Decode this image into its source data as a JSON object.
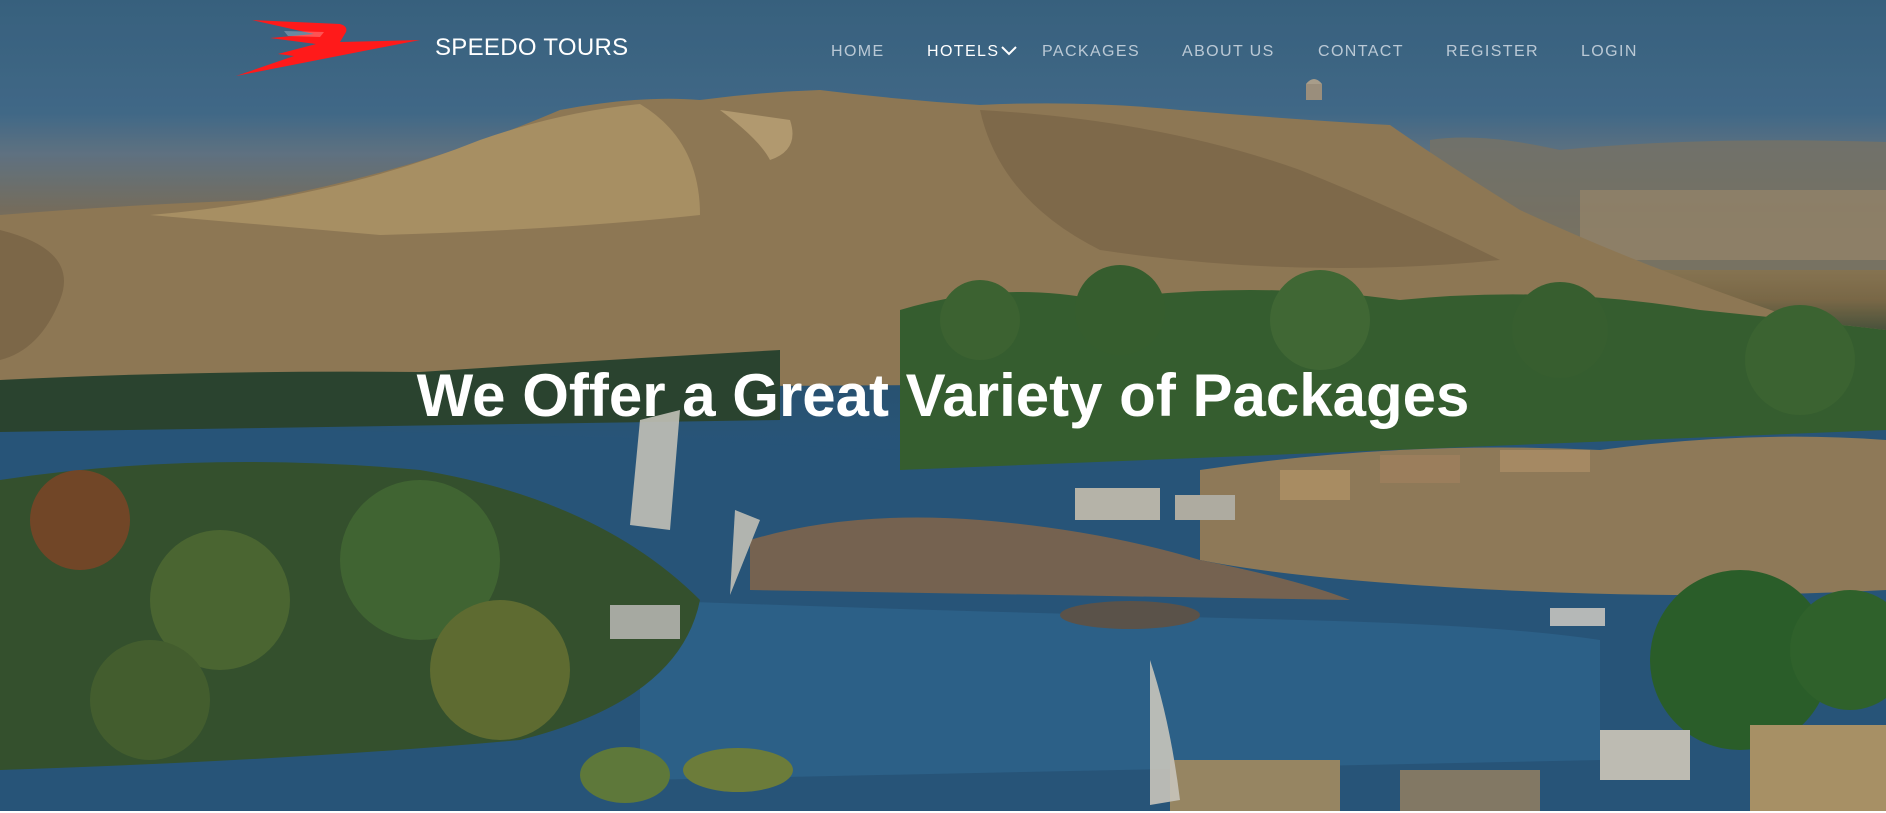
{
  "brand": {
    "name": "SPEEDO TOURS",
    "logo_icon": "speedo-wing-logo",
    "logo_color": "#ff1a1a"
  },
  "nav": {
    "items": [
      {
        "label": "HOME",
        "active": false
      },
      {
        "label": "HOTELS",
        "active": true,
        "has_dropdown": true
      },
      {
        "label": "PACKAGES",
        "active": false
      },
      {
        "label": "ABOUT US",
        "active": false
      },
      {
        "label": "CONTACT",
        "active": false
      },
      {
        "label": "REGISTER",
        "active": false
      },
      {
        "label": "LOGIN",
        "active": false
      }
    ],
    "dropdown_icon": "chevron-down-icon"
  },
  "hero": {
    "heading": "We Offer a Great Variety of Packages",
    "background": "nile-river-landscape-photo"
  },
  "colors": {
    "text_primary": "#ffffff",
    "nav_text": "#eaf0f5",
    "brand_red": "#ff1a1a",
    "sky": "#4a7797",
    "river": "#2b5f86",
    "dunes": "#a88d5e",
    "vegetation": "#3f6a2c"
  }
}
